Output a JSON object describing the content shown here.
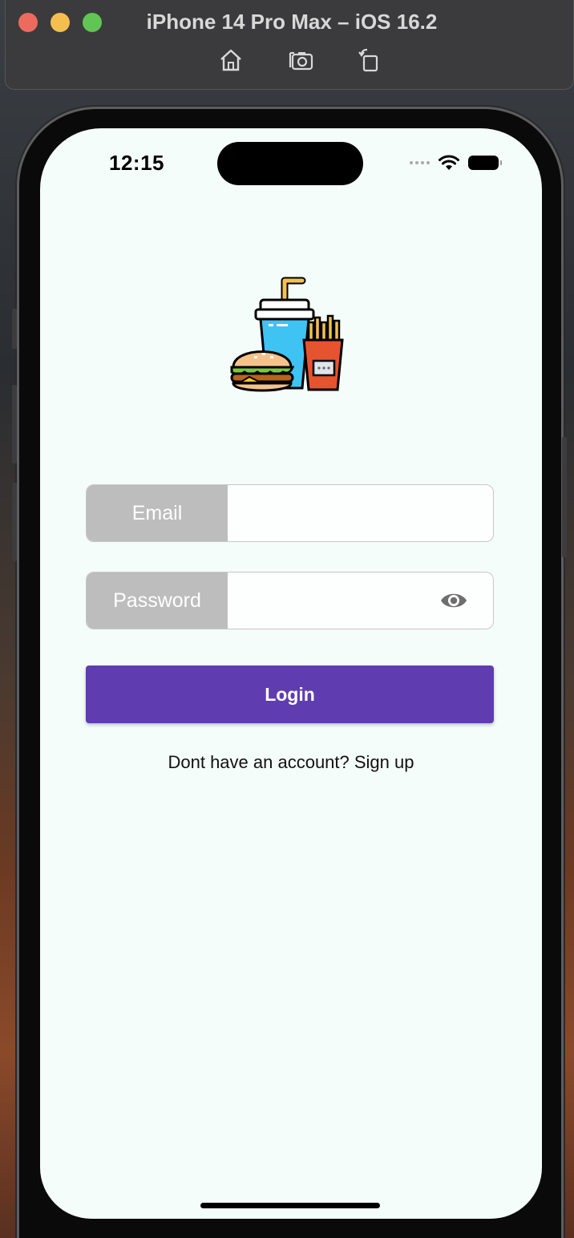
{
  "simulator": {
    "title": "iPhone 14 Pro Max – iOS 16.2",
    "toolbar_icons": [
      "home-icon",
      "screenshot-icon",
      "rotate-icon"
    ]
  },
  "status_bar": {
    "time": "12:15"
  },
  "login_form": {
    "email_label": "Email",
    "email_value": "",
    "password_label": "Password",
    "password_value": "",
    "login_button": "Login",
    "signup_text": "Dont have an account? Sign up"
  },
  "colors": {
    "accent": "#5f3db0",
    "label_bg": "#bdbdbd",
    "screen_bg": "#f5fdfb"
  }
}
